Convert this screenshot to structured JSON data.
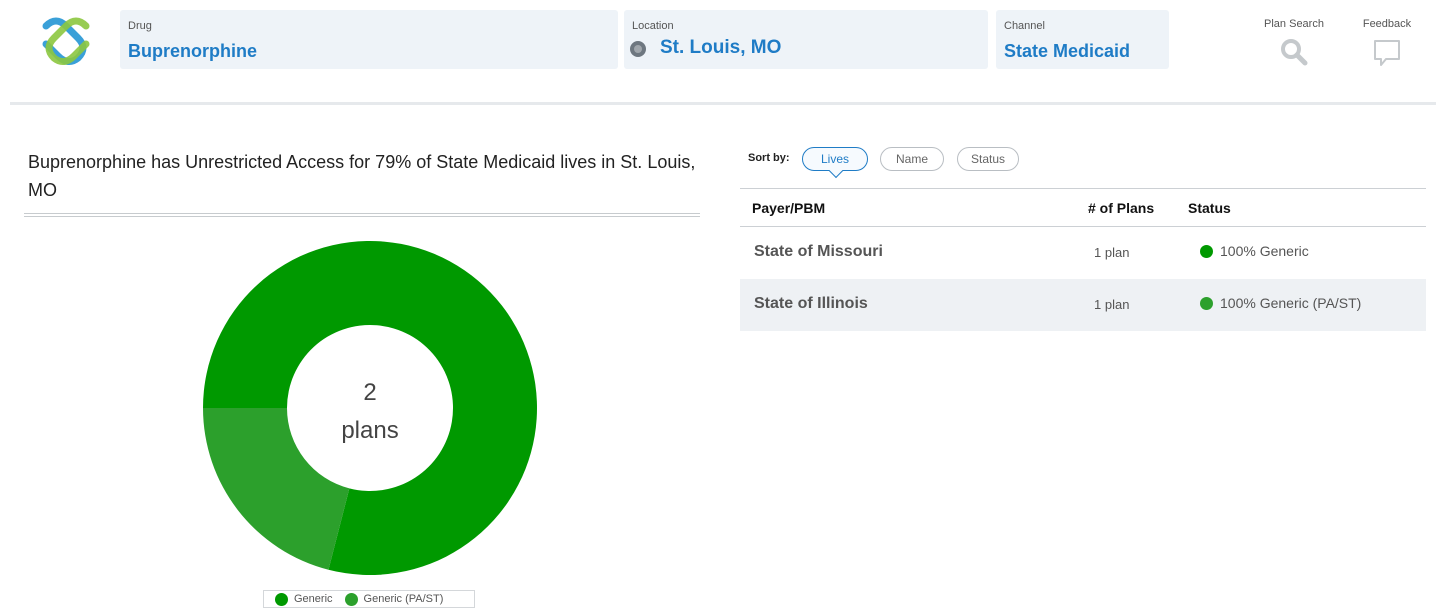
{
  "header": {
    "drug": {
      "label": "Drug",
      "value": "Buprenorphine"
    },
    "location": {
      "label": "Location",
      "value": "St. Louis, MO"
    },
    "channel": {
      "label": "Channel",
      "value": "State Medicaid"
    },
    "plan_search_label": "Plan Search",
    "feedback_label": "Feedback"
  },
  "summary": {
    "text": "Buprenorphine has Unrestricted Access for 79% of State Medicaid lives in St. Louis, MO"
  },
  "chart_data": {
    "type": "pie",
    "center_value": "2",
    "center_label": "plans",
    "slices": [
      {
        "name": "Generic",
        "value": 79,
        "color": "#009900"
      },
      {
        "name": "Generic (PA/ST)",
        "value": 21,
        "color": "#2ca02c"
      }
    ]
  },
  "legend": [
    {
      "label": "Generic",
      "color": "#009900"
    },
    {
      "label": "Generic (PA/ST)",
      "color": "#2ca02c"
    }
  ],
  "sort": {
    "label": "Sort by:",
    "options": [
      "Lives",
      "Name",
      "Status"
    ],
    "active": "Lives"
  },
  "table": {
    "headers": [
      "Payer/PBM",
      "# of Plans",
      "Status"
    ],
    "rows": [
      {
        "payer": "State of Missouri",
        "plans": "1 plan",
        "status": "100% Generic",
        "status_color": "#009900"
      },
      {
        "payer": "State of Illinois",
        "plans": "1 plan",
        "status": "100% Generic (PA/ST)",
        "status_color": "#2ca02c"
      }
    ]
  },
  "colors": {
    "accent": "#1f7cc6",
    "filter_bg": "#eef3f8"
  }
}
